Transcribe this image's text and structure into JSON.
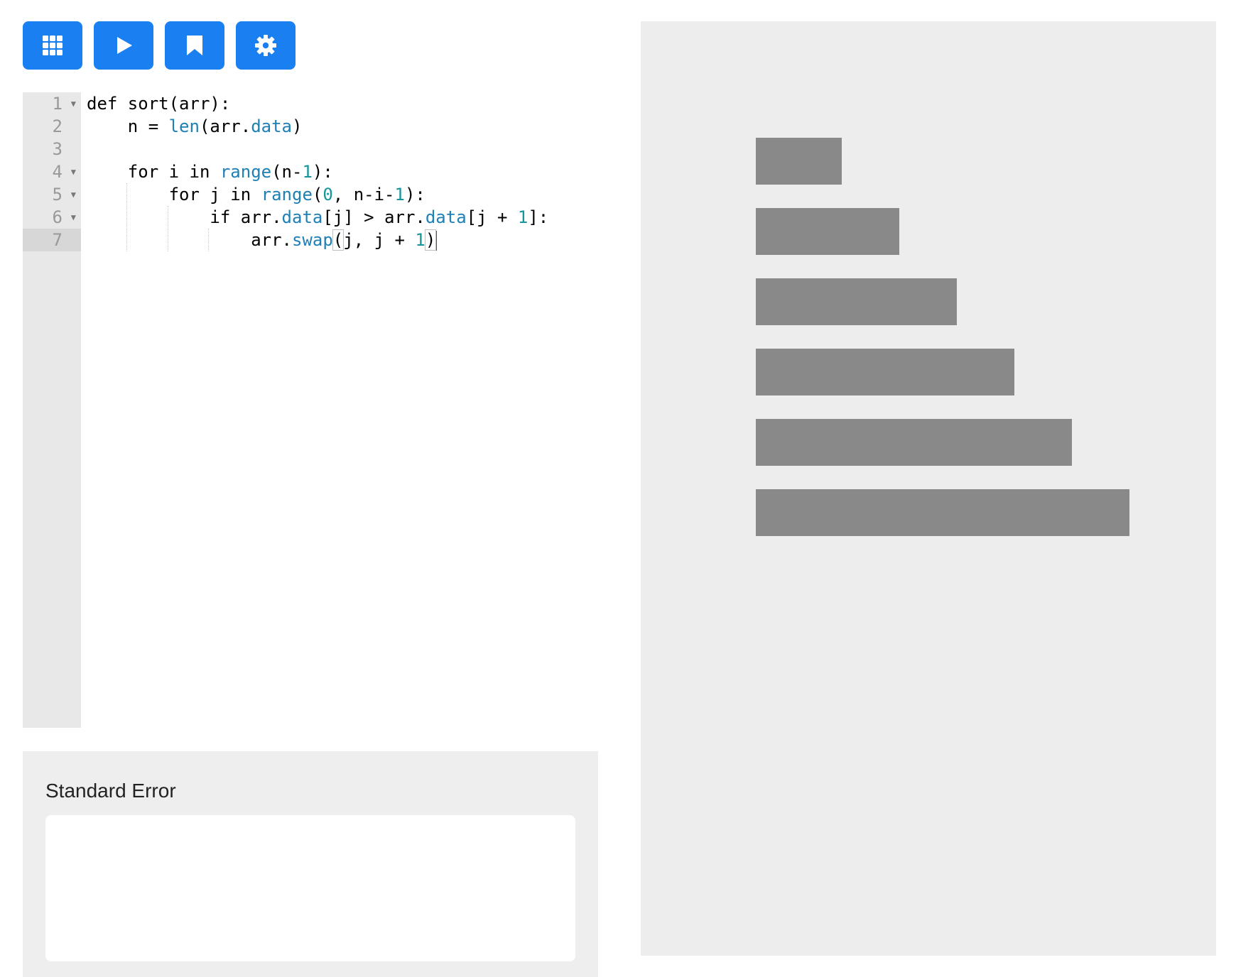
{
  "toolbar": {
    "buttons": [
      {
        "icon": "grid-icon",
        "label": "Menu"
      },
      {
        "icon": "play-icon",
        "label": "Run"
      },
      {
        "icon": "bookmark-icon",
        "label": "Bookmark"
      },
      {
        "icon": "gear-icon",
        "label": "Settings"
      }
    ],
    "accent_color": "#1a7ff0"
  },
  "editor": {
    "active_line": 7,
    "lines": [
      {
        "number": "1",
        "foldable": true
      },
      {
        "number": "2",
        "foldable": false
      },
      {
        "number": "3",
        "foldable": false
      },
      {
        "number": "4",
        "foldable": true
      },
      {
        "number": "5",
        "foldable": true
      },
      {
        "number": "6",
        "foldable": true
      },
      {
        "number": "7",
        "foldable": false
      }
    ],
    "code": [
      {
        "indent": "",
        "tokens": [
          {
            "t": "def sort(arr):",
            "k": "plain"
          }
        ]
      },
      {
        "indent": "    ",
        "tokens": [
          {
            "t": "n = ",
            "k": "plain"
          },
          {
            "t": "len",
            "k": "fn"
          },
          {
            "t": "(arr.",
            "k": "plain"
          },
          {
            "t": "data",
            "k": "fn"
          },
          {
            "t": ")",
            "k": "plain"
          }
        ]
      },
      {
        "indent": "",
        "tokens": []
      },
      {
        "indent": "    ",
        "tokens": [
          {
            "t": "for i in ",
            "k": "plain"
          },
          {
            "t": "range",
            "k": "fn"
          },
          {
            "t": "(n-",
            "k": "plain"
          },
          {
            "t": "1",
            "k": "num"
          },
          {
            "t": "):",
            "k": "plain"
          }
        ]
      },
      {
        "indent": "        ",
        "tokens": [
          {
            "t": "for j in ",
            "k": "plain"
          },
          {
            "t": "range",
            "k": "fn"
          },
          {
            "t": "(",
            "k": "plain"
          },
          {
            "t": "0",
            "k": "num"
          },
          {
            "t": ", n-i-",
            "k": "plain"
          },
          {
            "t": "1",
            "k": "num"
          },
          {
            "t": "):",
            "k": "plain"
          }
        ]
      },
      {
        "indent": "            ",
        "tokens": [
          {
            "t": "if arr.",
            "k": "plain"
          },
          {
            "t": "data",
            "k": "fn"
          },
          {
            "t": "[j] > arr.",
            "k": "plain"
          },
          {
            "t": "data",
            "k": "fn"
          },
          {
            "t": "[j + ",
            "k": "plain"
          },
          {
            "t": "1",
            "k": "num"
          },
          {
            "t": "]:",
            "k": "plain"
          }
        ]
      },
      {
        "indent": "                ",
        "tokens": [
          {
            "t": "arr.",
            "k": "plain"
          },
          {
            "t": "swap",
            "k": "fn"
          },
          {
            "t": "(",
            "k": "plain",
            "b": true
          },
          {
            "t": "j, j + ",
            "k": "plain"
          },
          {
            "t": "1",
            "k": "num"
          },
          {
            "t": ")",
            "k": "plain",
            "b": true
          }
        ]
      }
    ]
  },
  "stderr": {
    "title": "Standard Error",
    "content": ""
  },
  "visualization": {
    "bar_color": "#898989",
    "array_values": [
      3,
      5,
      7,
      9,
      11,
      13
    ],
    "max_value": 13
  }
}
